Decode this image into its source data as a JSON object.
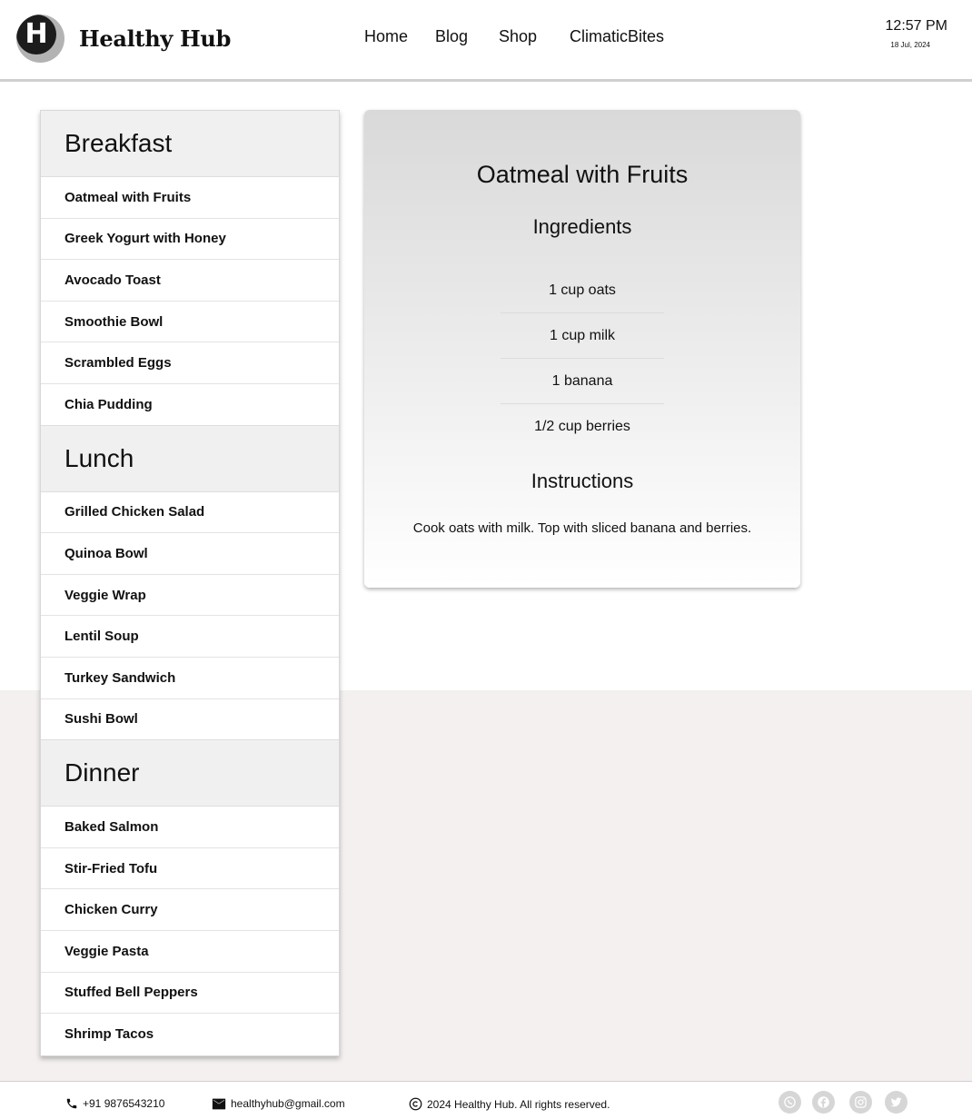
{
  "header": {
    "logo_letter": "H",
    "brand": "Healthy Hub",
    "nav": [
      "Home",
      "Blog",
      "Shop",
      "ClimaticBites"
    ],
    "time": "12:57 PM",
    "date": "18 Jul, 2024"
  },
  "sidebar": {
    "sections": [
      {
        "title": "Breakfast",
        "items": [
          "Oatmeal with Fruits",
          "Greek Yogurt with Honey",
          "Avocado Toast",
          "Smoothie Bowl",
          "Scrambled Eggs",
          "Chia Pudding"
        ]
      },
      {
        "title": "Lunch",
        "items": [
          "Grilled Chicken Salad",
          "Quinoa Bowl",
          "Veggie Wrap",
          "Lentil Soup",
          "Turkey Sandwich",
          "Sushi Bowl"
        ]
      },
      {
        "title": "Dinner",
        "items": [
          "Baked Salmon",
          "Stir-Fried Tofu",
          "Chicken Curry",
          "Veggie Pasta",
          "Stuffed Bell Peppers",
          "Shrimp Tacos"
        ]
      }
    ]
  },
  "recipe": {
    "title": "Oatmeal with Fruits",
    "ingredients_heading": "Ingredients",
    "ingredients": [
      "1  cup oats",
      "1 cup milk",
      "1 banana",
      "1/2 cup berries"
    ],
    "instructions_heading": "Instructions",
    "instructions": "Cook oats with milk. Top with sliced banana and berries."
  },
  "footer": {
    "phone": "+91 9876543210",
    "email": "healthyhub@gmail.com",
    "copyright": "2024 Healthy Hub. All rights reserved.",
    "social_icons": [
      "whatsapp-icon",
      "facebook-icon",
      "instagram-icon",
      "twitter-icon"
    ],
    "social_color": "#d6d6d6"
  }
}
